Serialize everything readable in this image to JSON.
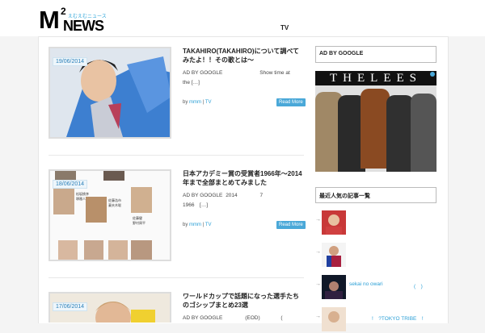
{
  "site": {
    "logo_m": "M",
    "logo_2": "2",
    "logo_news": "NEWS",
    "logo_tagline": "えむえむニュース"
  },
  "nav": {
    "tv": "TV"
  },
  "posts": [
    {
      "date": "19/06/2014",
      "title": "TAKAHIRO(TAKAHIRO)について調べてみたよ！！その歌とは〜",
      "excerpt_ad": "AD BY GOOGLE",
      "excerpt_rest": "Show time at",
      "excerpt_line2": "the […]",
      "meta_by": "by",
      "meta_author": "mmm",
      "meta_sep": "|",
      "meta_category": "TV",
      "read_more": "Read More"
    },
    {
      "date": "18/06/2014",
      "title": "日本アカデミー賞の受賞者1966年〜2014年まで全部まとめてみました",
      "excerpt_ad": "AD BY GOOGLE",
      "excerpt_year": "2014",
      "excerpt_num": "7",
      "excerpt_line2": "1966　[…]",
      "meta_by": "by",
      "meta_author": "mmm",
      "meta_sep": "|",
      "meta_category": "TV",
      "read_more": "Read More",
      "thumb_labels": [
        "松坂桃李",
        "堺雅人",
        "佐藤浩市",
        "妻夫木聡",
        "佐藤健",
        "野村周平"
      ]
    },
    {
      "date": "17/06/2014",
      "title": "ワールドカップで話題になった選手たちのゴシップまとめ23選",
      "excerpt_ad": "AD BY GOOGLE",
      "excerpt_eod": "(EOD)",
      "excerpt_paren": "("
    }
  ],
  "sidebar": {
    "ad_heading": "AD BY GOOGLE",
    "ad_banner_text": "THELEES",
    "popular_heading": "最近人気の記事一覧",
    "items": [
      {
        "text": ""
      },
      {
        "text": ""
      },
      {
        "text": "sekai no owari",
        "text2": "(　)"
      },
      {
        "text": "!　?TOKYO TRIBE　!"
      }
    ]
  },
  "colors": {
    "accent": "#2a9fd6",
    "read_more_bg": "#4aa8d8",
    "date_text": "#2a7fb8"
  }
}
